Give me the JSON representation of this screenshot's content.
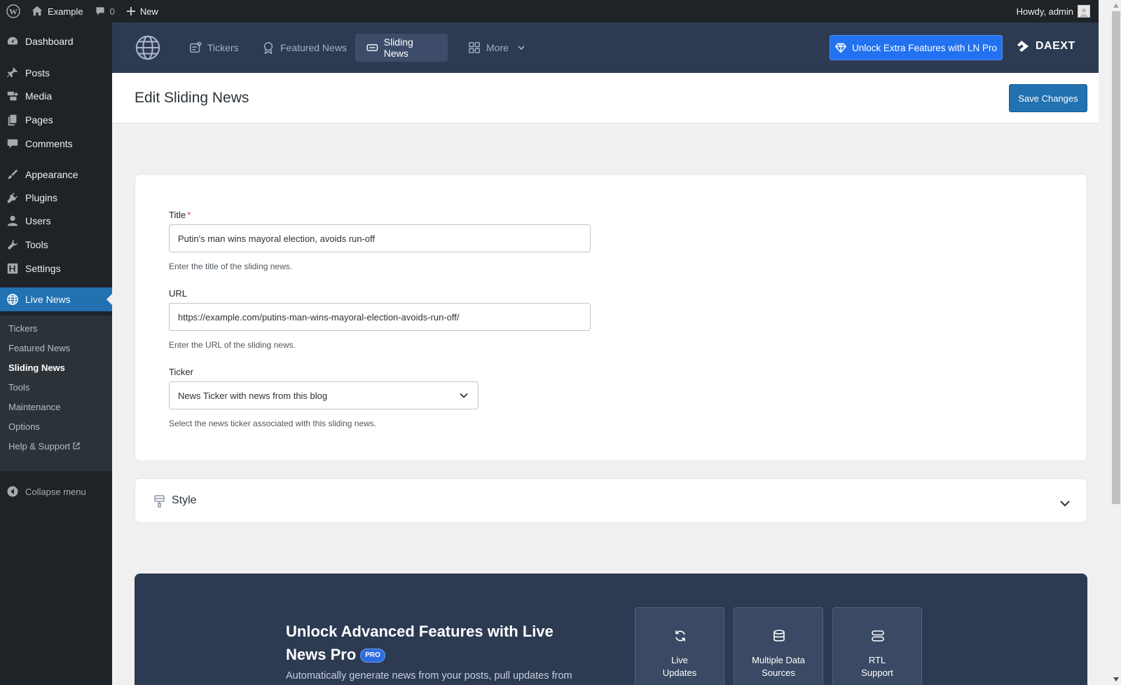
{
  "admin_bar": {
    "site_name": "Example",
    "comments_count": "0",
    "new_label": "New",
    "howdy": "Howdy, admin"
  },
  "sidebar": {
    "items": [
      {
        "label": "Dashboard",
        "icon": "dashboard-icon"
      },
      {
        "label": "Posts",
        "icon": "pin-icon"
      },
      {
        "label": "Media",
        "icon": "media-icon"
      },
      {
        "label": "Pages",
        "icon": "pages-icon"
      },
      {
        "label": "Comments",
        "icon": "comment-icon"
      },
      {
        "label": "Appearance",
        "icon": "brush-icon"
      },
      {
        "label": "Plugins",
        "icon": "plugin-icon"
      },
      {
        "label": "Users",
        "icon": "user-icon"
      },
      {
        "label": "Tools",
        "icon": "wrench-icon"
      },
      {
        "label": "Settings",
        "icon": "settings-icon"
      },
      {
        "label": "Live News",
        "icon": "globe-icon"
      }
    ],
    "submenu": [
      "Tickers",
      "Featured News",
      "Sliding News",
      "Tools",
      "Maintenance",
      "Options",
      "Help & Support"
    ],
    "collapse_label": "Collapse menu"
  },
  "plugin_nav": {
    "tabs": [
      "Tickers",
      "Featured News",
      "Sliding News",
      "More"
    ],
    "active_tab": "Sliding News",
    "unlock_label": "Unlock Extra Features with LN Pro",
    "brand": "DAEXT"
  },
  "page": {
    "title": "Edit Sliding News",
    "save_label": "Save Changes"
  },
  "form": {
    "title_label": "Title",
    "required_mark": "*",
    "title_value": "Putin's man wins mayoral election, avoids run-off",
    "title_help": "Enter the title of the sliding news.",
    "url_label": "URL",
    "url_value": "https://example.com/putins-man-wins-mayoral-election-avoids-run-off/",
    "url_help": "Enter the URL of the sliding news.",
    "ticker_label": "Ticker",
    "ticker_value": "News Ticker with news from this blog",
    "ticker_help": "Select the news ticker associated with this sliding news."
  },
  "style_section": {
    "title": "Style"
  },
  "promo": {
    "title": "Unlock Advanced Features with Live News Pro",
    "badge": "PRO",
    "description": "Automatically generate news from your posts, pull updates from",
    "features": [
      {
        "line1": "Live",
        "line2": "Updates"
      },
      {
        "line1": "Multiple Data",
        "line2": "Sources"
      },
      {
        "line1": "RTL",
        "line2": "Support"
      }
    ]
  }
}
